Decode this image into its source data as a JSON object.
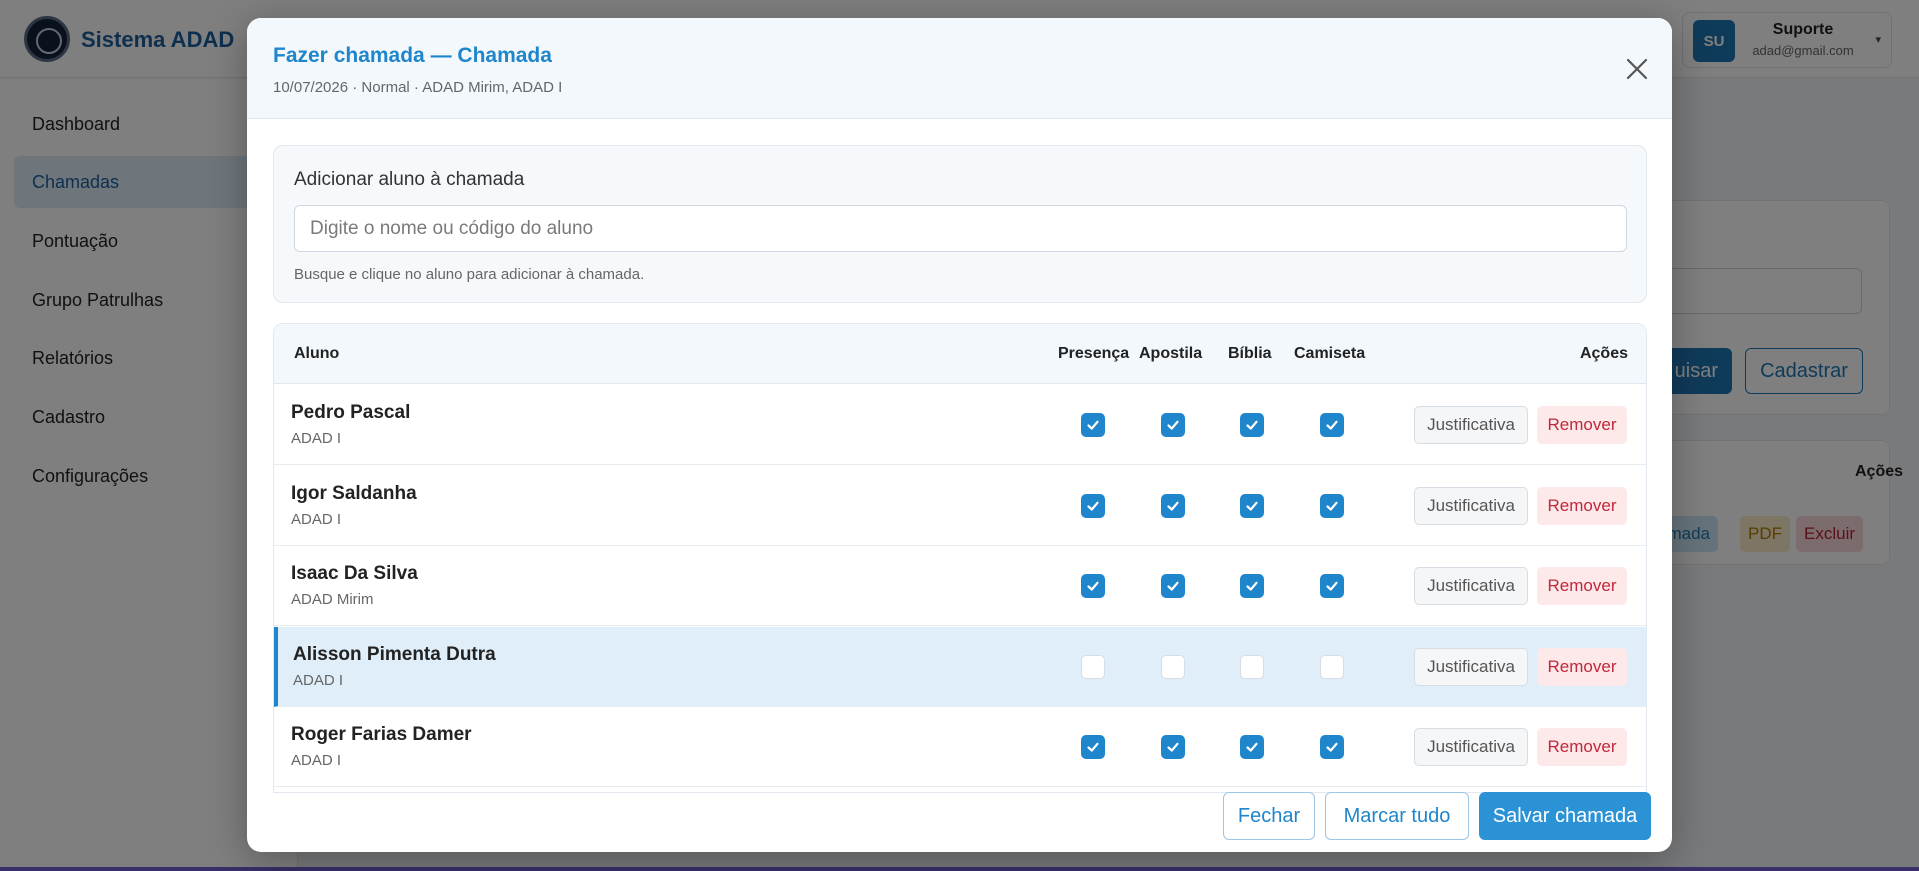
{
  "app": {
    "brand": "Sistema ADAD",
    "user": {
      "initials": "SU",
      "name": "Suporte",
      "email": "adad@gmail.com"
    }
  },
  "sidebar": {
    "items": [
      {
        "label": "Dashboard",
        "active": false
      },
      {
        "label": "Chamadas",
        "active": true
      },
      {
        "label": "Pontuação",
        "active": false
      },
      {
        "label": "Grupo Patrulhas",
        "active": false
      },
      {
        "label": "Relatórios",
        "active": false
      },
      {
        "label": "Cadastro",
        "active": false
      },
      {
        "label": "Configurações",
        "active": false
      }
    ]
  },
  "background": {
    "search_button_partial": "uisar",
    "register_button": "Cadastrar",
    "actions_header": "Ações",
    "chip_chamada_partial": "amada",
    "chip_pdf": "PDF",
    "chip_excluir": "Excluir"
  },
  "modal": {
    "title": "Fazer chamada — Chamada",
    "subtitle": "10/07/2026 · Normal · ADAD Mirim, ADAD I",
    "add_student": {
      "label": "Adicionar aluno à chamada",
      "placeholder": "Digite o nome ou código do aluno",
      "value": "",
      "hint": "Busque e clique no aluno para adicionar à chamada."
    },
    "table": {
      "columns": {
        "aluno": "Aluno",
        "presenca": "Presença",
        "apostila": "Apostila",
        "biblia": "Bíblia",
        "camiseta": "Camiseta",
        "acoes": "Ações"
      },
      "rows": [
        {
          "name": "Pedro Pascal",
          "group": "ADAD I",
          "presenca": true,
          "apostila": true,
          "biblia": true,
          "camiseta": true,
          "selected": false
        },
        {
          "name": "Igor Saldanha",
          "group": "ADAD I",
          "presenca": true,
          "apostila": true,
          "biblia": true,
          "camiseta": true,
          "selected": false
        },
        {
          "name": "Isaac Da Silva",
          "group": "ADAD Mirim",
          "presenca": true,
          "apostila": true,
          "biblia": true,
          "camiseta": true,
          "selected": false
        },
        {
          "name": "Alisson Pimenta Dutra",
          "group": "ADAD I",
          "presenca": false,
          "apostila": false,
          "biblia": false,
          "camiseta": false,
          "selected": true
        },
        {
          "name": "Roger Farias Damer",
          "group": "ADAD I",
          "presenca": true,
          "apostila": true,
          "biblia": true,
          "camiseta": true,
          "selected": false
        }
      ],
      "justify_label": "Justificativa",
      "remove_label": "Remover"
    },
    "footer": {
      "close_label": "Fechar",
      "mark_all_label": "Marcar tudo",
      "save_label": "Salvar chamada"
    }
  },
  "colors": {
    "accent": "#1f86cc",
    "danger": "#c0283b",
    "selected_row": "#dfeef9"
  }
}
